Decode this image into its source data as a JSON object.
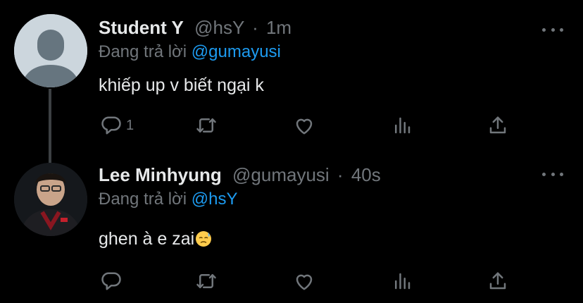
{
  "tweets": [
    {
      "name": "Student Y",
      "handle": "@hsY",
      "separator": "·",
      "time": "1m",
      "replying_to_label": "Đang trả lời",
      "replying_to": "@gumayusi",
      "text": "khiếp up v biết ngại k",
      "reply_count": "1",
      "avatar": "default-profile-icon"
    },
    {
      "name": "Lee Minhyung",
      "handle": "@gumayusi",
      "separator": "·",
      "time": "40s",
      "replying_to_label": "Đang trả lời",
      "replying_to": "@hsY",
      "text": "ghen à e zai",
      "text_emoji": "downcast-face-with-sweat-emoji",
      "reply_count": "",
      "avatar": "profile-photo"
    }
  ],
  "icons": {
    "reply": "reply-icon",
    "retweet": "retweet-icon",
    "like": "heart-icon",
    "analytics": "analytics-icon",
    "share": "share-icon",
    "more": "more-icon"
  },
  "colors": {
    "background": "#000000",
    "text": "#e7e9ea",
    "secondary": "#71767b",
    "accent": "#1d9bf0",
    "thread_line": "#3c4043"
  }
}
